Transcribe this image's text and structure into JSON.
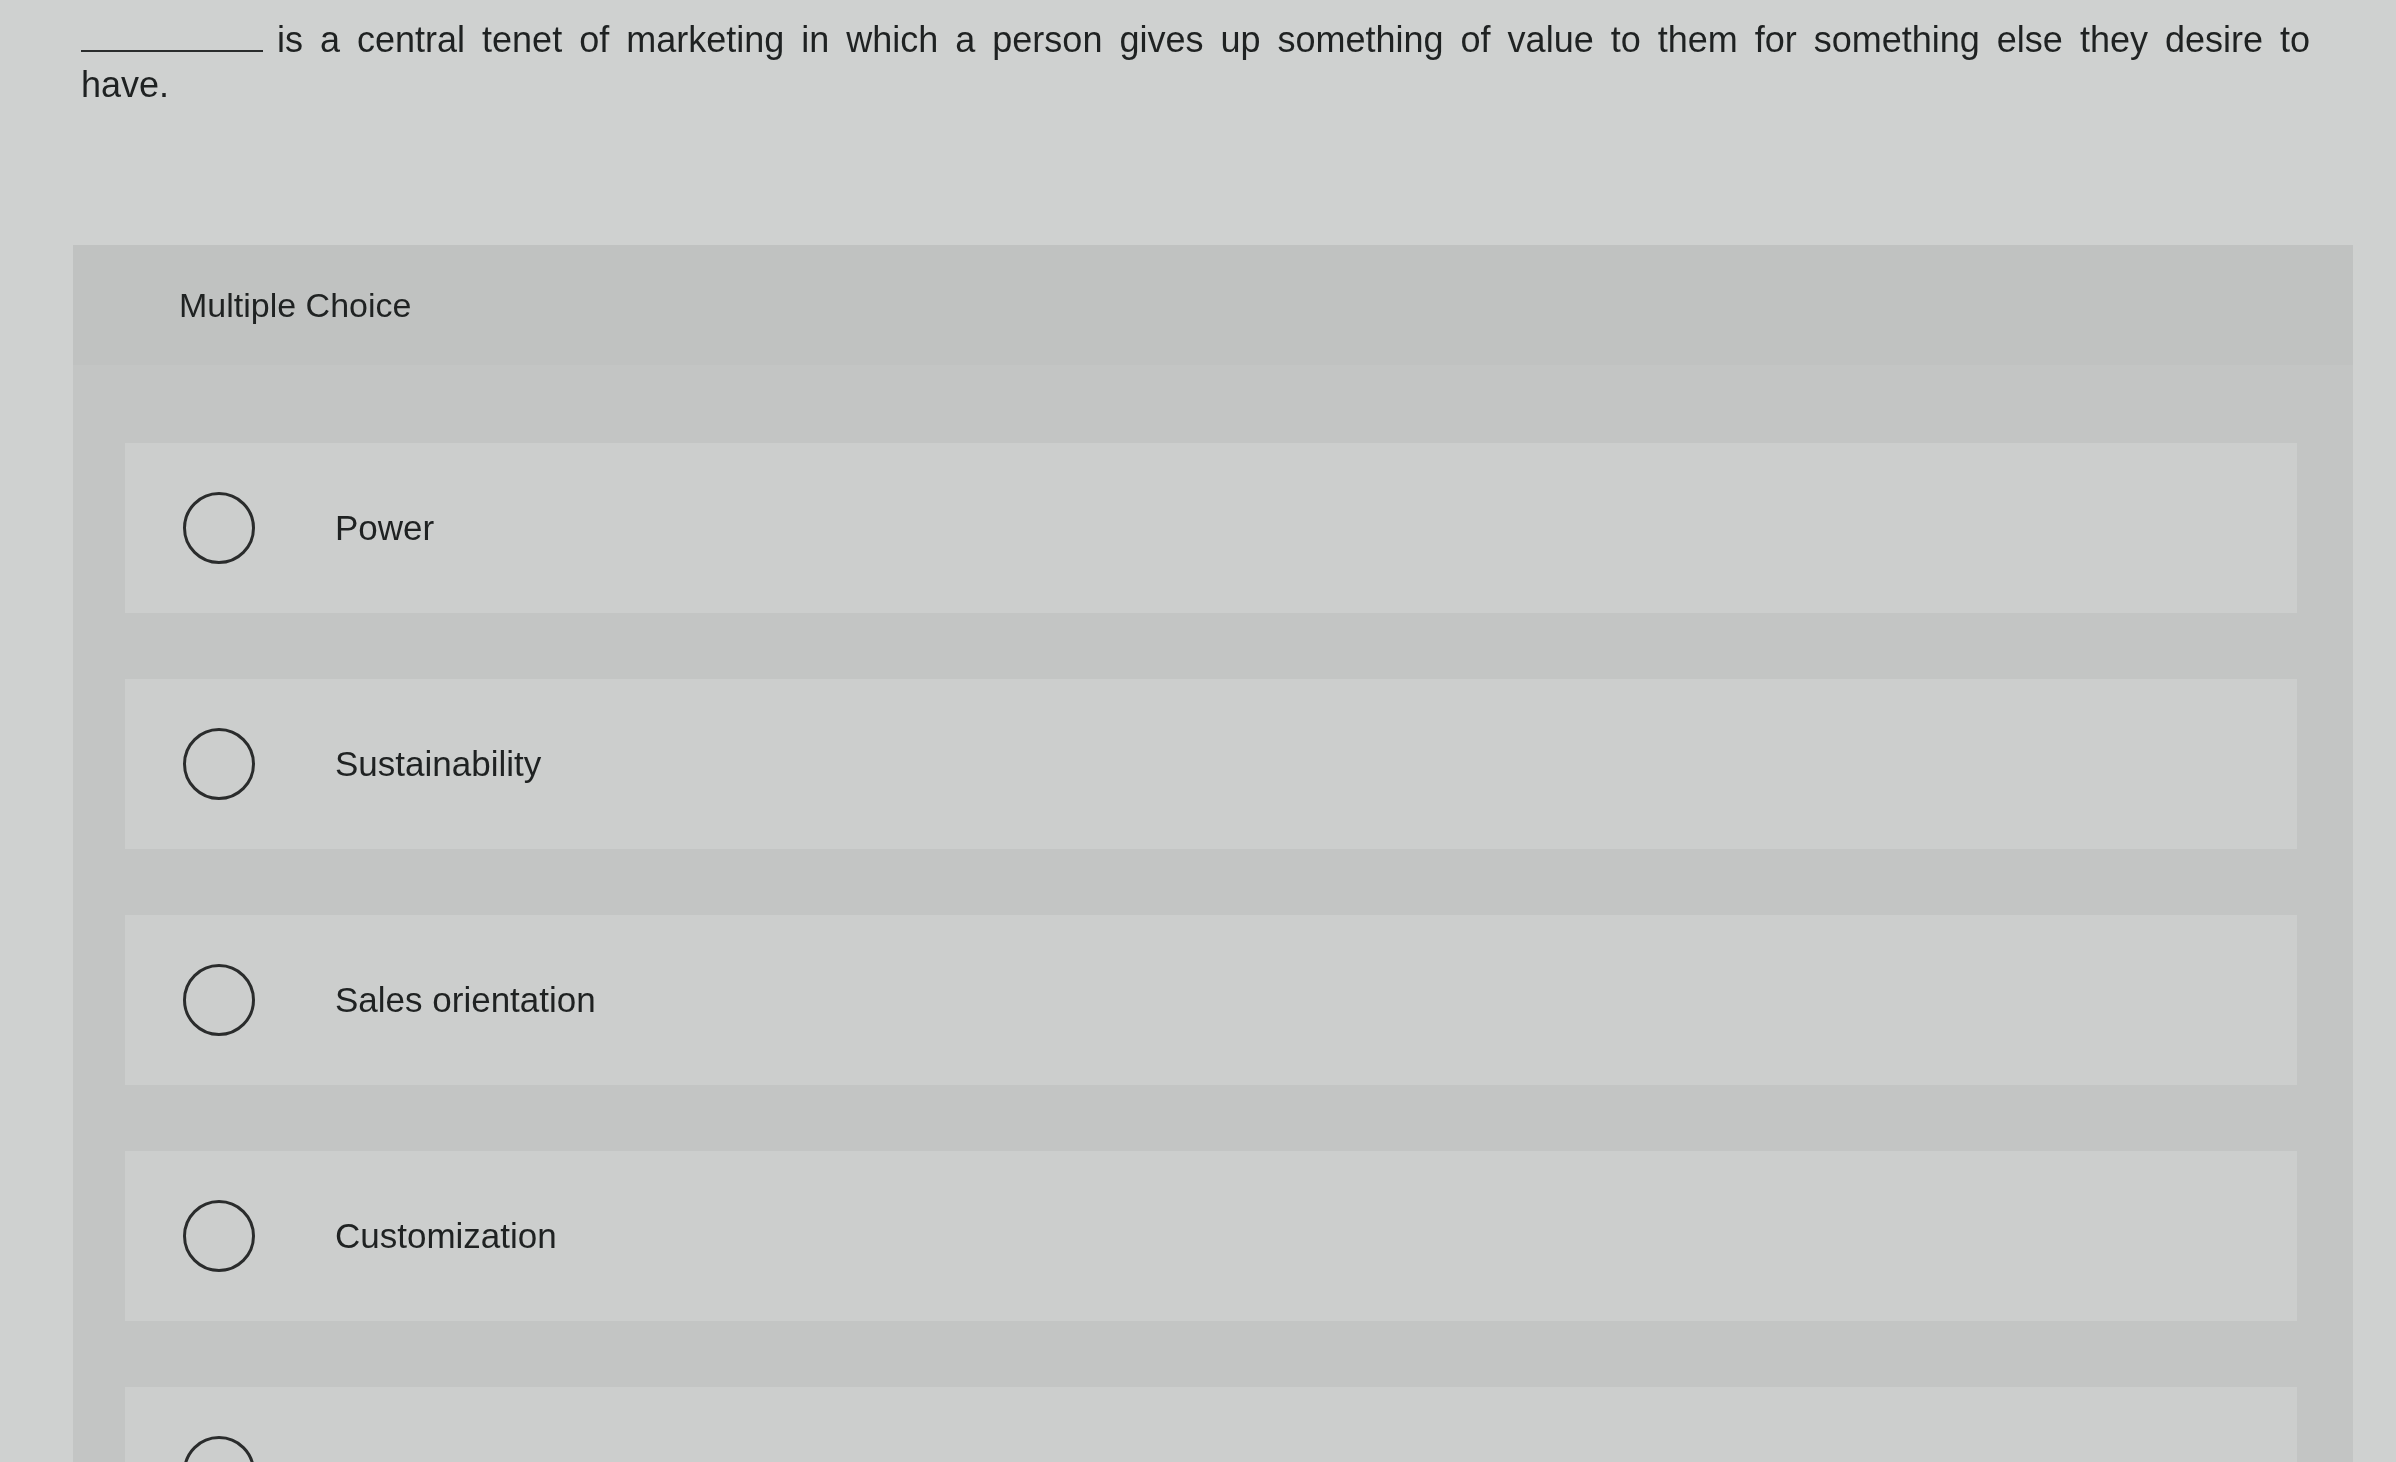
{
  "question": {
    "parts": [
      {
        "kind": "blank"
      },
      {
        "kind": "text",
        "text": "is a central tenet of marketing in which a person gives up something of value to them for something else they desire to have."
      }
    ]
  },
  "question_type": "Multiple Choice",
  "options": [
    {
      "label": "Power",
      "selected": false
    },
    {
      "label": "Sustainability",
      "selected": false
    },
    {
      "label": "Sales orientation",
      "selected": false
    },
    {
      "label": "Customization",
      "selected": false
    },
    {
      "selected": false
    }
  ]
}
